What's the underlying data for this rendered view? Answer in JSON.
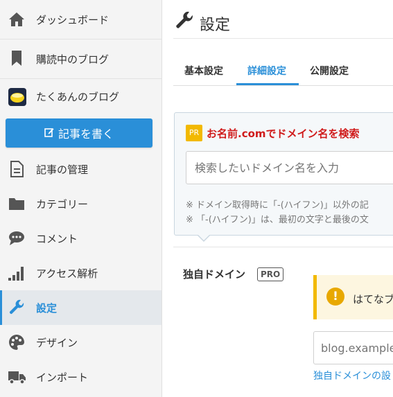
{
  "sidebar": {
    "items": [
      {
        "label": "ダッシュボード",
        "icon": "home-icon"
      },
      {
        "label": "購読中のブログ",
        "icon": "bookmark-icon"
      },
      {
        "label": "たくあんのブログ",
        "icon": "blog-avatar-icon"
      },
      {
        "label": "記事の管理",
        "icon": "document-icon"
      },
      {
        "label": "カテゴリー",
        "icon": "folder-icon"
      },
      {
        "label": "コメント",
        "icon": "comment-icon"
      },
      {
        "label": "アクセス解析",
        "icon": "bar-chart-icon"
      },
      {
        "label": "設定",
        "icon": "wrench-icon"
      },
      {
        "label": "デザイン",
        "icon": "palette-icon"
      },
      {
        "label": "インポート",
        "icon": "truck-icon"
      }
    ],
    "write_button": "記事を書く"
  },
  "header": {
    "title": "設定"
  },
  "tabs": [
    {
      "label": "基本設定"
    },
    {
      "label": "詳細設定"
    },
    {
      "label": "公開設定"
    }
  ],
  "pr": {
    "badge": "PR",
    "title": "お名前.comでドメイン名を検索",
    "search_placeholder": "検索したいドメイン名を入力",
    "note1": "※ ドメイン取得時に「-(ハイフン)」以外の記",
    "note2": "※ 「-(ハイフン)」は、最初の文字と最後の文"
  },
  "domain": {
    "label": "独自ドメイン",
    "pro": "PRO",
    "warning": "はてなブ",
    "input_placeholder": "blog.example",
    "link": "独自ドメインの設"
  },
  "colors": {
    "accent": "#2a8fd8",
    "warning": "#f2b900",
    "pr_title": "#d01b1b"
  }
}
